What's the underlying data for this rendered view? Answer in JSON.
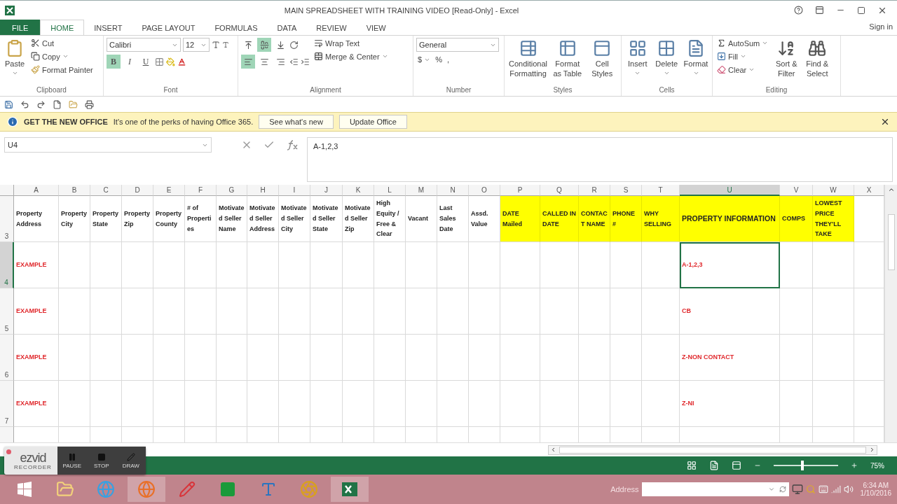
{
  "window": {
    "title": "MAIN SPREADSHEET WITH TRAINING VIDEO  [Read-Only] - Excel",
    "sign_in": "Sign in"
  },
  "ribbon": {
    "tabs": [
      {
        "label": "FILE",
        "kind": "file",
        "selected": false
      },
      {
        "label": "HOME",
        "kind": "tab",
        "selected": true
      },
      {
        "label": "INSERT",
        "kind": "tab",
        "selected": false
      },
      {
        "label": "PAGE LAYOUT",
        "kind": "tab",
        "selected": false
      },
      {
        "label": "FORMULAS",
        "kind": "tab",
        "selected": false
      },
      {
        "label": "DATA",
        "kind": "tab",
        "selected": false
      },
      {
        "label": "REVIEW",
        "kind": "tab",
        "selected": false
      },
      {
        "label": "VIEW",
        "kind": "tab",
        "selected": false
      }
    ],
    "clipboard": {
      "group": "Clipboard",
      "paste": "Paste",
      "cut": "Cut",
      "copy": "Copy",
      "format_painter": "Format Painter"
    },
    "font": {
      "group": "Font",
      "name": "Calibri",
      "size": "12",
      "styles": [
        {
          "glyph": "B",
          "kind": "bold",
          "on": true
        },
        {
          "glyph": "I",
          "kind": "italic",
          "on": false
        },
        {
          "glyph": "U",
          "kind": "underline",
          "on": false
        }
      ]
    },
    "alignment": {
      "group": "Alignment",
      "vertical": [
        {
          "on": false
        },
        {
          "on": true
        },
        {
          "on": false
        }
      ],
      "horizontal": [
        {
          "on": true
        },
        {
          "on": false
        },
        {
          "on": false
        }
      ],
      "wrap_text": "Wrap Text",
      "merge": "Merge & Center"
    },
    "number": {
      "group": "Number",
      "format": "General",
      "currency": "$",
      "percent": "%",
      "comma": ","
    },
    "styles": {
      "group": "Styles",
      "buttons": [
        "Conditional Formatting",
        "Format as Table",
        "Cell Styles"
      ]
    },
    "cells": {
      "group": "Cells",
      "buttons": [
        "Insert",
        "Delete",
        "Format"
      ]
    },
    "editing": {
      "group": "Editing",
      "autosum": "AutoSum",
      "fill": "Fill",
      "clear": "Clear",
      "buttons": [
        "Sort & Filter",
        "Find & Select"
      ]
    }
  },
  "info_bar": {
    "title": "GET THE NEW OFFICE",
    "message": "It's one of the perks of having Office 365.",
    "buttons": [
      "See what's new",
      "Update Office"
    ]
  },
  "formula_bar": {
    "name_box": "U4",
    "value": "A-1,2,3"
  },
  "sheet": {
    "columns": [
      {
        "letter": "A",
        "selected": false
      },
      {
        "letter": "B",
        "selected": false
      },
      {
        "letter": "C",
        "selected": false
      },
      {
        "letter": "D",
        "selected": false
      },
      {
        "letter": "E",
        "selected": false
      },
      {
        "letter": "F",
        "selected": false
      },
      {
        "letter": "G",
        "selected": false
      },
      {
        "letter": "H",
        "selected": false
      },
      {
        "letter": "I",
        "selected": false
      },
      {
        "letter": "J",
        "selected": false
      },
      {
        "letter": "K",
        "selected": false
      },
      {
        "letter": "L",
        "selected": false
      },
      {
        "letter": "M",
        "selected": false
      },
      {
        "letter": "N",
        "selected": false
      },
      {
        "letter": "O",
        "selected": false
      },
      {
        "letter": "P",
        "selected": false
      },
      {
        "letter": "Q",
        "selected": false
      },
      {
        "letter": "R",
        "selected": false
      },
      {
        "letter": "S",
        "selected": false
      },
      {
        "letter": "T",
        "selected": false
      },
      {
        "letter": "U",
        "selected": true
      },
      {
        "letter": "V",
        "selected": false
      },
      {
        "letter": "W",
        "selected": false
      },
      {
        "letter": "X",
        "selected": false
      }
    ],
    "header_row": {
      "number": "3",
      "cells": [
        {
          "text": "Property Address",
          "highlighted": false
        },
        {
          "text": "Property City",
          "highlighted": false
        },
        {
          "text": "Property State",
          "highlighted": false
        },
        {
          "text": "Property Zip",
          "highlighted": false
        },
        {
          "text": "Property County",
          "highlighted": false
        },
        {
          "text": "# of Properties",
          "highlighted": false
        },
        {
          "text": "Motivated Seller Name",
          "highlighted": false
        },
        {
          "text": "Motivated Seller Address",
          "highlighted": false
        },
        {
          "text": "Motivated Seller City",
          "highlighted": false
        },
        {
          "text": "Motivated Seller State",
          "highlighted": false
        },
        {
          "text": "Motivated Seller Zip",
          "highlighted": false
        },
        {
          "text": "High Equity / Free & Clear",
          "highlighted": false
        },
        {
          "text": "Vacant",
          "highlighted": false
        },
        {
          "text": "Last Sales Date",
          "highlighted": false
        },
        {
          "text": "Assd. Value",
          "highlighted": false
        },
        {
          "text": "DATE Mailed",
          "highlighted": true
        },
        {
          "text": "CALLED IN DATE",
          "highlighted": true
        },
        {
          "text": "CONTACT NAME",
          "highlighted": true
        },
        {
          "text": "PHONE #",
          "highlighted": true
        },
        {
          "text": "WHY SELLING",
          "highlighted": true
        },
        {
          "text": "PROPERTY INFORMATION",
          "highlighted": true
        },
        {
          "text": "COMPS",
          "highlighted": true
        },
        {
          "text": "LOWEST PRICE THEY'LL TAKE",
          "highlighted": true
        }
      ]
    },
    "rows": [
      {
        "number": "4",
        "selected": true,
        "label": "EXAMPLE",
        "property_information": "A-1,2,3"
      },
      {
        "number": "5",
        "selected": false,
        "label": "EXAMPLE",
        "property_information": "CB"
      },
      {
        "number": "6",
        "selected": false,
        "label": "EXAMPLE",
        "property_information": "Z-NON CONTACT"
      },
      {
        "number": "7",
        "selected": false,
        "label": "EXAMPLE",
        "property_information": "Z-NI"
      }
    ]
  },
  "recorder": {
    "logo": "ezvid",
    "subtitle": "RECORDER",
    "buttons": [
      "PAUSE",
      "STOP",
      "DRAW"
    ]
  },
  "status_bar": {
    "zoom": {
      "level": 0.45,
      "reading": "75%"
    }
  },
  "taskbar": {
    "address_label": "Address",
    "time": "6:34 AM",
    "date": "1/10/2016"
  }
}
